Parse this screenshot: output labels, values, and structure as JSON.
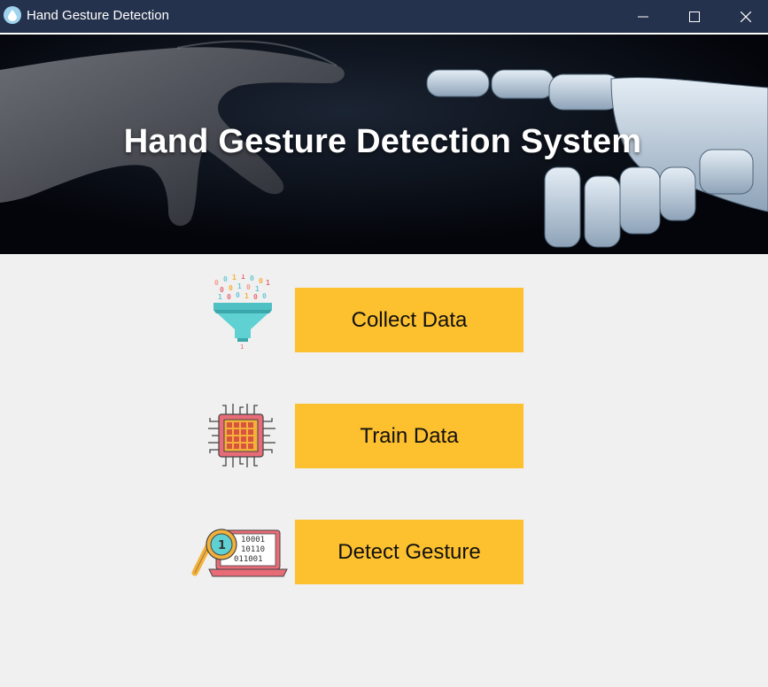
{
  "window": {
    "title": "Hand Gesture Detection",
    "icon": "app-drop-icon",
    "controls": [
      "minimize-icon",
      "maximize-icon",
      "close-icon"
    ]
  },
  "banner": {
    "title": "Hand Gesture Detection System"
  },
  "actions": [
    {
      "label": "Collect Data",
      "icon": "data-funnel-icon"
    },
    {
      "label": "Train Data",
      "icon": "processor-chip-icon"
    },
    {
      "label": "Detect Gesture",
      "icon": "laptop-magnifier-icon"
    }
  ],
  "colors": {
    "titlebar": "#25324d",
    "button": "#fdc02e",
    "background": "#f0f0f0"
  }
}
